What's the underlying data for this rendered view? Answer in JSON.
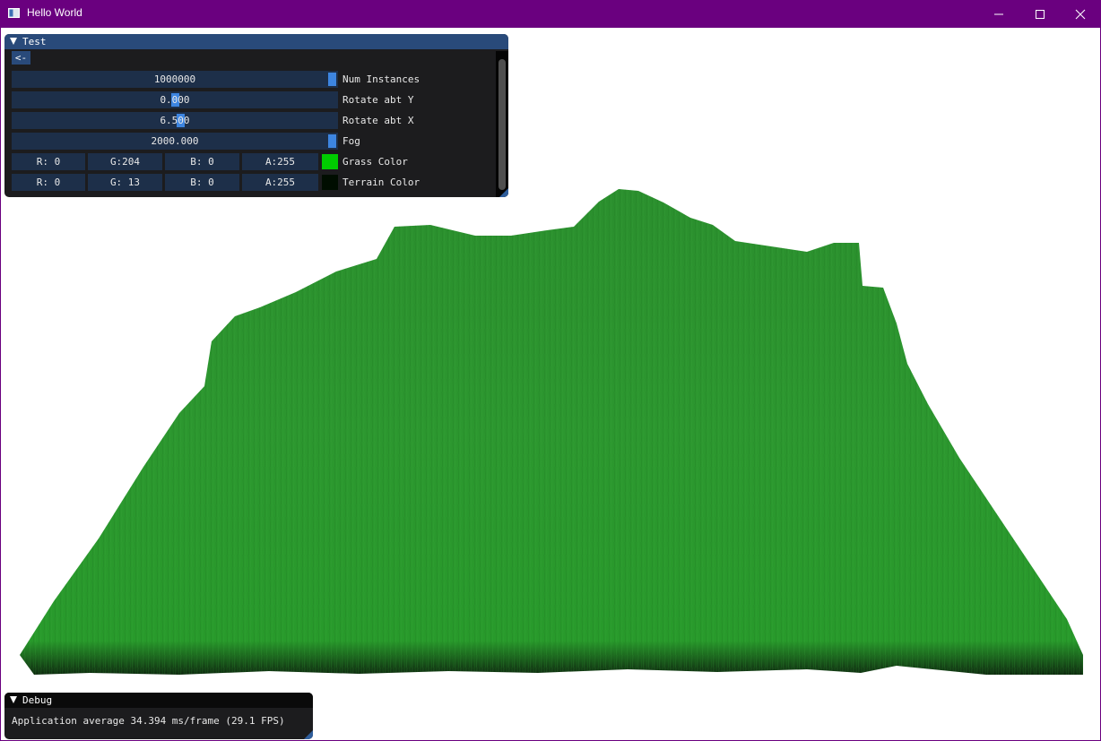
{
  "window": {
    "title": "Hello World",
    "minimize_icon": "minimize-icon",
    "maximize_icon": "maximize-icon",
    "close_icon": "close-icon",
    "frame_color": "#6a007f"
  },
  "test_panel": {
    "title": "Test",
    "back_label": "<-",
    "num_instances": {
      "value": "1000000",
      "label": "Num Instances",
      "fraction": 1.0
    },
    "rotate_y": {
      "value": "0.000",
      "label": "Rotate abt Y"
    },
    "rotate_x": {
      "value": "6.500",
      "label": "Rotate abt X"
    },
    "fog": {
      "value": "2000.000",
      "label": "Fog",
      "fraction": 1.0
    },
    "grass_color": {
      "r": "R:  0",
      "g": "G:204",
      "b": "B:  0",
      "a": "A:255",
      "label": "Grass Color",
      "hex": "#00cc00"
    },
    "terrain_color": {
      "r": "R:  0",
      "g": "G: 13",
      "b": "B:  0",
      "a": "A:255",
      "label": "Terrain Color",
      "hex": "#000d00"
    }
  },
  "debug_panel": {
    "title": "Debug",
    "stats": "Application average 34.394 ms/frame (29.1 FPS)"
  },
  "colors": {
    "grass": "#2a962c",
    "title_active": "#294a7a",
    "slider_grab": "#3d85e0"
  }
}
